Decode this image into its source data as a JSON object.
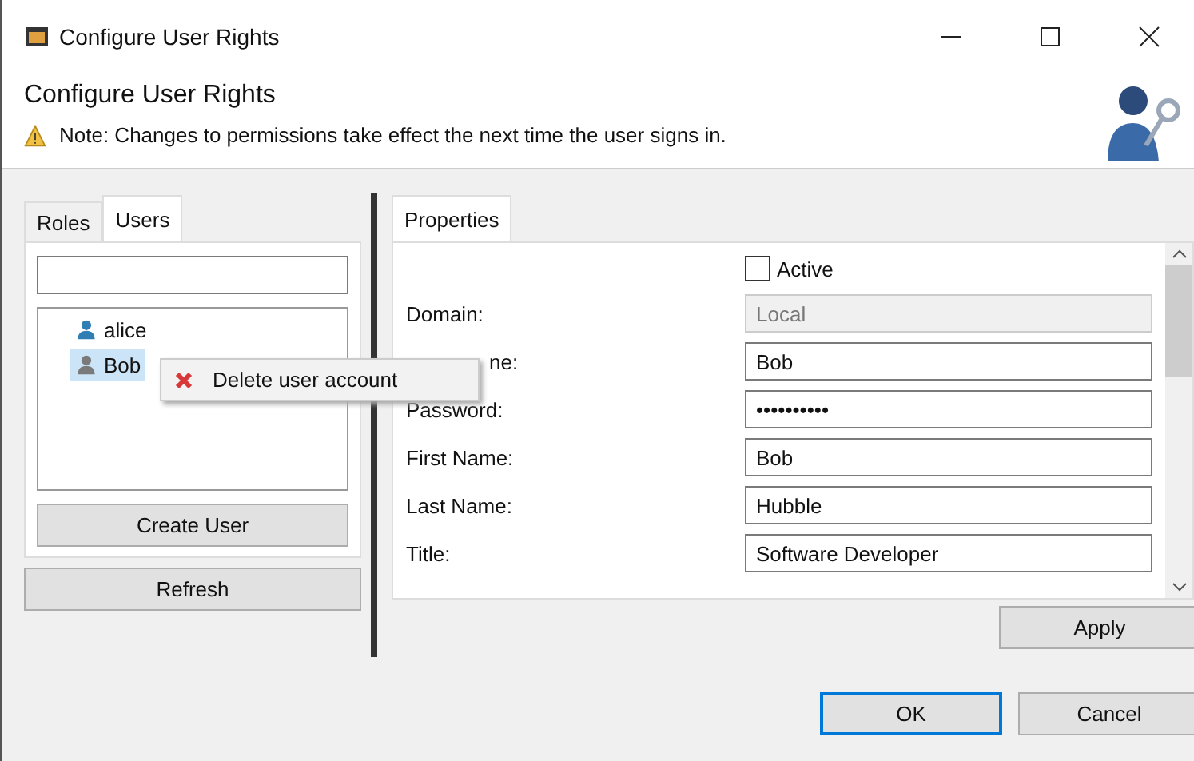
{
  "window": {
    "title": "Configure User Rights"
  },
  "header": {
    "title": "Configure User Rights",
    "note": "Note: Changes to permissions take effect the next time the user signs in."
  },
  "left_tabs": [
    {
      "label": "Roles",
      "selected": false
    },
    {
      "label": "Users",
      "selected": true
    }
  ],
  "users": [
    {
      "name": "alice",
      "selected": false,
      "color": "#2f7fb5"
    },
    {
      "name": "Bob",
      "selected": true,
      "color": "#7a7a7a"
    }
  ],
  "context_menu": {
    "items": [
      "Delete user account"
    ]
  },
  "create_button": "Create User",
  "refresh_button": "Refresh",
  "right_tabs": [
    {
      "label": "Properties",
      "selected": true
    }
  ],
  "active": {
    "label": "Active",
    "checked": false
  },
  "fields": [
    {
      "label": "Domain:",
      "value": "Local",
      "disabled": true
    },
    {
      "label": "ne:",
      "value": "Bob",
      "disabled": false
    },
    {
      "label": "Password:",
      "value": "••••••••••",
      "disabled": false
    },
    {
      "label": "First Name:",
      "value": "Bob",
      "disabled": false
    },
    {
      "label": "Last Name:",
      "value": "Hubble",
      "disabled": false
    },
    {
      "label": "Title:",
      "value": "Software Developer",
      "disabled": false
    }
  ],
  "apply_button": "Apply",
  "buttons": [
    "OK",
    "Cancel"
  ]
}
